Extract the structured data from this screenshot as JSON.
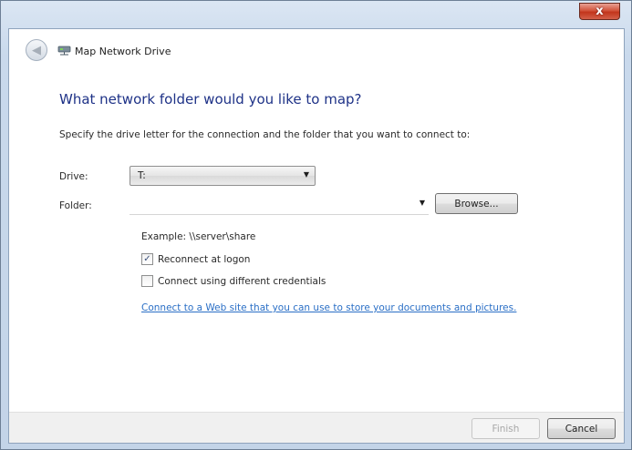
{
  "window": {
    "close_icon": "close-icon",
    "close_glyph": "x"
  },
  "header": {
    "title": "Map Network Drive",
    "back_icon": "back-arrow-icon",
    "drive_icon": "network-drive-icon"
  },
  "main": {
    "heading": "What network folder would you like to map?",
    "instruction": "Specify the drive letter for the connection and the folder that you want to connect to:",
    "drive_label": "Drive:",
    "drive_value": "T:",
    "folder_label": "Folder:",
    "folder_value": "",
    "browse_label": "Browse...",
    "example_text": "Example: \\\\server\\share",
    "reconnect_label": "Reconnect at logon",
    "reconnect_checked": true,
    "credentials_label": "Connect using different credentials",
    "credentials_checked": false,
    "web_link": "Connect to a Web site that you can use to store your documents and pictures."
  },
  "footer": {
    "finish_label": "Finish",
    "cancel_label": "Cancel"
  },
  "colors": {
    "heading": "#1e3287",
    "link": "#2a6fc6",
    "close_button": "#c2351c"
  }
}
